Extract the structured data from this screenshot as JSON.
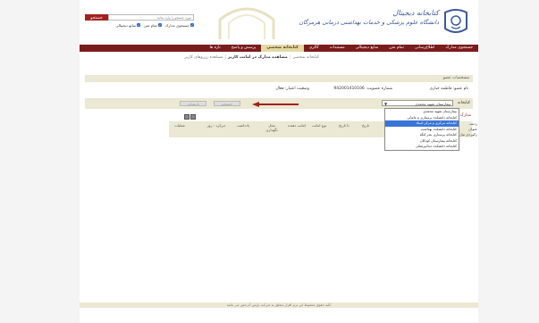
{
  "header": {
    "title_line1": "کتابخانه دیجیتال",
    "title_line2": "دانشگاه علوم پزشکی و خدمات بهداشتی درمانی هرمزگان",
    "search_placeholder": "مورد جستجو را وارد نمائید",
    "search_button": "جستجو",
    "checkboxes": [
      "جستجوی مدارک",
      "تمام متن",
      "منابع دیجیتالی"
    ]
  },
  "nav": {
    "items": [
      "جستجوی مدارک",
      "اطلاع‌رسانی",
      "تمام متن",
      "منابع دیجیتالی",
      "مستندات",
      "گالری",
      "کتابخانه شخصی",
      "پرسش و پاسخ",
      "تازه ها"
    ],
    "active_index": 6
  },
  "breadcrumb": {
    "items": [
      "کتابخانه شخصی",
      "مشاهده مدارک در امانت کاربر",
      "مشاهده رزروهای کاربر"
    ],
    "active_index": 1,
    "separator": "|"
  },
  "member": {
    "panel_title": "مشخصات عضو",
    "name": "نام عضو: فاطمه جباری",
    "membership_no": "شماره عضویت: 94200141010​6",
    "status": "وضعیت اعتبار: فعال"
  },
  "library": {
    "label": "کتابخانه",
    "selected": "بیمارستان شهید محمدی",
    "search_button": "جستجو",
    "reset_button": "بازنشانی",
    "options": [
      "بیمارستان شهید محمدی",
      "کتابخانه دانشکده پرستاری و مامایی",
      "کتابخانه مرکزی و مرکز اسناد",
      "کتابخانه دانشکده بهداشت",
      "کتابخانه پرستاری بندر لنگه",
      "کتابخانه بیمارستان کودکان",
      "کتابخانه دانشکده دندانپزشکی"
    ],
    "highlighted_index": 2
  },
  "docs": {
    "label": "مدارک در",
    "side_labels": [
      "ردیف",
      "عنوان",
      "رکوردی نیاز"
    ],
    "columns": [
      "عملیات",
      "دیرکرد - روز",
      "یادداشت",
      "محل نگهداری",
      "امانت دهنده",
      "نوع امانت",
      "تا تاریخ",
      "تاریخ"
    ]
  },
  "footer": {
    "text": "کلیه حقوق محفوظ این نرم افزار متعلق به شرکت پارس آذرخش می باشد"
  },
  "colors": {
    "nav_bg": "#7a1c1c",
    "accent": "#a32020",
    "panel_bg": "#ebe8d3",
    "selected": "#3875d7"
  }
}
